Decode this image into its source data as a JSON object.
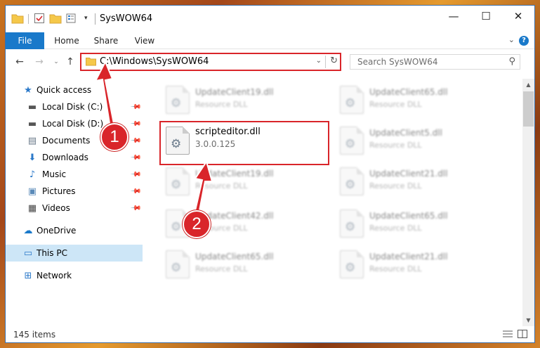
{
  "window": {
    "title": "SysWOW64"
  },
  "controls": {
    "minimize": "—",
    "maximize": "☐",
    "close": "✕"
  },
  "ribbon": {
    "tabs": [
      "File",
      "Home",
      "Share",
      "View"
    ],
    "expand_glyph": "⌄",
    "help_glyph": "?"
  },
  "nav": {
    "back": "←",
    "forward": "→",
    "recent": "⌄",
    "up": "↑",
    "address": "C:\\Windows\\SysWOW64",
    "address_dropdown": "⌄",
    "refresh": "↻",
    "search_placeholder": "Search SysWOW64",
    "search_glyph": "⚲"
  },
  "sidebar": {
    "items": [
      {
        "label": "Quick access",
        "icon": "star-icon",
        "glyph": "★",
        "color": "#2b79c9",
        "pinned": false
      },
      {
        "label": "Local Disk (C:)",
        "icon": "drive-icon",
        "glyph": "▬",
        "color": "#555555",
        "pinned": true
      },
      {
        "label": "Local Disk (D:)",
        "icon": "drive-icon",
        "glyph": "▬",
        "color": "#555555",
        "pinned": true
      },
      {
        "label": "Documents",
        "icon": "documents-icon",
        "glyph": "▤",
        "color": "#6a7a8a",
        "pinned": true
      },
      {
        "label": "Downloads",
        "icon": "download-icon",
        "glyph": "⬇",
        "color": "#2b79c9",
        "pinned": true
      },
      {
        "label": "Music",
        "icon": "music-icon",
        "glyph": "♪",
        "color": "#2b79c9",
        "pinned": true
      },
      {
        "label": "Pictures",
        "icon": "pictures-icon",
        "glyph": "▣",
        "color": "#5a8ab8",
        "pinned": true
      },
      {
        "label": "Videos",
        "icon": "videos-icon",
        "glyph": "▦",
        "color": "#444444",
        "pinned": true
      },
      {
        "label": "OneDrive",
        "icon": "cloud-icon",
        "glyph": "☁",
        "color": "#1979ca",
        "pinned": false
      },
      {
        "label": "This PC",
        "icon": "monitor-icon",
        "glyph": "▭",
        "color": "#2b79c9",
        "pinned": false
      },
      {
        "label": "Network",
        "icon": "network-icon",
        "glyph": "⊞",
        "color": "#2b79c9",
        "pinned": false
      }
    ],
    "pin_glyph": "📌"
  },
  "files": [
    {
      "name": "UpdateClient19.dll",
      "type": "Resource DLL"
    },
    {
      "name": "UpdateClient65.dll",
      "type": "Resource DLL"
    },
    {
      "name": "scripteditor.dll",
      "type": "3.0.0.125"
    },
    {
      "name": "UpdateClient5.dll",
      "type": "Resource DLL"
    },
    {
      "name": "UpdateClient19.dll",
      "type": "Resource DLL"
    },
    {
      "name": "UpdateClient21.dll",
      "type": "Resource DLL"
    },
    {
      "name": "UpdateClient42.dll",
      "type": "Resource DLL"
    },
    {
      "name": "UpdateClient65.dll",
      "type": "Resource DLL"
    },
    {
      "name": "UpdateClient65.dll",
      "type": "Resource DLL"
    },
    {
      "name": "UpdateClient21.dll",
      "type": "Resource DLL"
    }
  ],
  "status": {
    "item_count": "145 items"
  },
  "callouts": [
    "1",
    "2"
  ],
  "colors": {
    "accent": "#1979ca",
    "highlight_red": "#d9252a",
    "selected_bg": "#cde6f7"
  }
}
